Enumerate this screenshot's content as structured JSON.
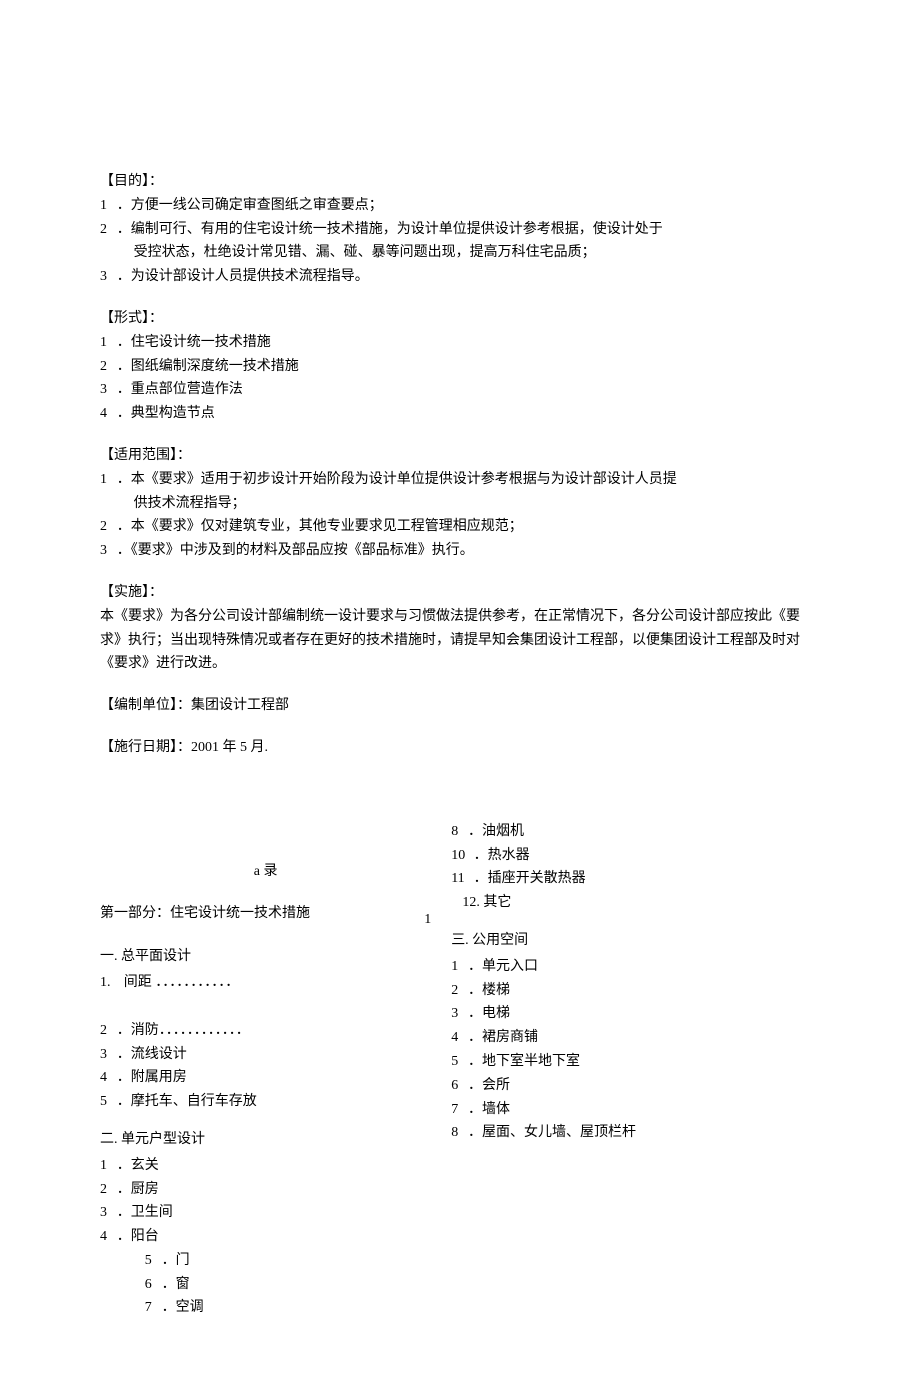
{
  "sections": {
    "purpose": {
      "title": "【目的】：",
      "items": [
        {
          "num": "1",
          "text": "．方便一线公司确定审查图纸之审查要点；"
        },
        {
          "num": "2",
          "text": "．编制可行、有用的住宅设计统一技术措施，为设计单位提供设计参考根据，使设计处于",
          "cont": "受控状态，杜绝设计常见错、漏、碰、暴等问题出现，提高万科住宅品质；"
        },
        {
          "num": "3",
          "text": "．为设计部设计人员提供技术流程指导。"
        }
      ]
    },
    "form": {
      "title": "【形式】：",
      "items": [
        {
          "num": "1",
          "text": "．住宅设计统一技术措施"
        },
        {
          "num": "2",
          "text": "．图纸编制深度统一技术措施"
        },
        {
          "num": "3",
          "text": "．重点部位营造作法"
        },
        {
          "num": "4",
          "text": "．典型构造节点"
        }
      ]
    },
    "scope": {
      "title": "【适用范围】：",
      "items": [
        {
          "num": "1",
          "text": "．本《要求》适用于初步设计开始阶段为设计单位提供设计参考根据与为设计部设计人员提",
          "cont": "供技术流程指导；"
        },
        {
          "num": "2",
          "text": "．本《要求》仅对建筑专业，其他专业要求见工程管理相应规范；"
        },
        {
          "num": "3",
          "text": "．《要求》中涉及到的材料及部品应按《部品标准》执行。"
        }
      ]
    },
    "impl": {
      "title": "【实施】：",
      "body": "本《要求》为各分公司设计部编制统一设计要求与习惯做法提供参考，在正常情况下，各分公司设计部应按此《要求》执行；当出现特殊情况或者存在更好的技术措施时，请提早知会集团设计工程部，以便集团设计工程部及时对《要求》进行改进。"
    },
    "author": {
      "label": "【编制单位】：",
      "value": "集团设计工程部"
    },
    "date": {
      "label": "【施行日期】：",
      "value": "2001 年 5 月."
    }
  },
  "toc": {
    "header": "a 录",
    "part_header": "第一部分：住宅设计统一技术措施",
    "part_pagenum": "1",
    "left": {
      "group1": {
        "title": "一. 总平面设计",
        "items": [
          {
            "num": "1.",
            "text": "间距",
            "dots": "．．．．．．．．．．．"
          },
          {
            "gap": true
          },
          {
            "num": "2",
            "text": "．消防．．．．．．．．．．．．"
          },
          {
            "num": "3",
            "text": "．流线设计"
          },
          {
            "num": "4",
            "text": "．附属用房"
          },
          {
            "num": "5",
            "text": "．摩托车、自行车存放"
          }
        ]
      },
      "group2": {
        "title": "二. 单元户型设计",
        "items": [
          {
            "num": "1",
            "text": "．玄关"
          },
          {
            "num": "2",
            "text": "．厨房"
          },
          {
            "num": "3",
            "text": "．卫生间"
          },
          {
            "num": "4",
            "text": "．阳台"
          }
        ],
        "subitems": [
          {
            "num": "5",
            "text": "．门"
          },
          {
            "num": "6",
            "text": "．窗"
          },
          {
            "num": "7",
            "text": "．空调"
          }
        ]
      }
    },
    "right": {
      "topitems": [
        {
          "num": "8",
          "text": "．油烟机"
        },
        {
          "num": "10",
          "text": "．热水器"
        },
        {
          "num": "11",
          "text": "．插座开关散热器"
        },
        {
          "num": "12.",
          "text": "其它",
          "infix": " "
        }
      ],
      "group3": {
        "title": "三. 公用空间",
        "items": [
          {
            "num": "1",
            "text": "．单元入口"
          },
          {
            "num": "2",
            "text": "．楼梯"
          },
          {
            "num": "3",
            "text": "．电梯"
          },
          {
            "num": "4",
            "text": "．裙房商铺"
          },
          {
            "num": "5",
            "text": "．地下室半地下室"
          },
          {
            "num": "6",
            "text": "．会所"
          },
          {
            "num": "7",
            "text": "．墙体"
          },
          {
            "num": "8",
            "text": "．屋面、女儿墙、屋顶栏杆"
          }
        ]
      }
    }
  }
}
